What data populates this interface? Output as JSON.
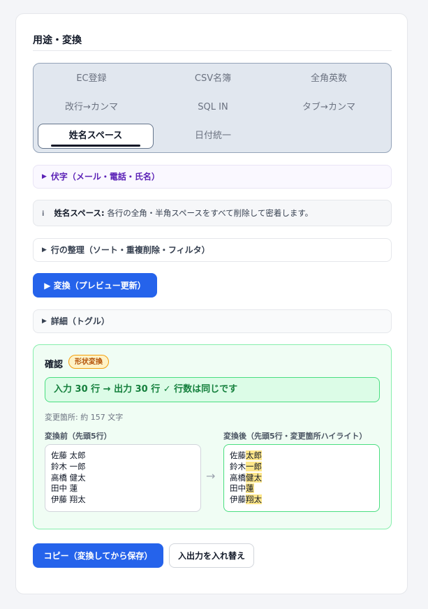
{
  "title": "用途・変換",
  "tabs": [
    {
      "label": "EC登録"
    },
    {
      "label": "CSV名簿"
    },
    {
      "label": "全角英数"
    },
    {
      "label": "改行→カンマ"
    },
    {
      "label": "SQL IN"
    },
    {
      "label": "タブ→カンマ"
    },
    {
      "label": "姓名スペース",
      "active": true
    },
    {
      "label": "日付統一"
    }
  ],
  "fuseji": {
    "label": "伏字（メール・電話・氏名）"
  },
  "info": {
    "icon": "i",
    "bold": "姓名スペース:",
    "text": "各行の全角・半角スペースをすべて削除して密着します。"
  },
  "rows_panel": {
    "label": "行の整理（ソート・重複削除・フィルタ）"
  },
  "convert_button": "▶ 変換（プレビュー更新）",
  "detail_panel": {
    "label": "詳細（トグル）"
  },
  "confirm": {
    "title": "確認",
    "badge": "形状変換",
    "result": "入力 30 行 → 出力 30 行 ✓ 行数は同じです",
    "changes": "変更箇所: 約 157 文字",
    "before_label": "変換前（先頭5行）",
    "after_label": "変換後（先頭5行・変更箇所ハイライト）",
    "arrow": "→",
    "before_lines": [
      "佐藤 太郎",
      "鈴木 一郎",
      "高橋 健太",
      "田中 蓮",
      "伊藤 翔太"
    ],
    "after_lines": [
      {
        "keep": "佐藤",
        "changed": "太郎"
      },
      {
        "keep": "鈴木",
        "changed": "一郎"
      },
      {
        "keep": "高橋",
        "changed": "健太"
      },
      {
        "keep": "田中",
        "changed": "蓮"
      },
      {
        "keep": "伊藤",
        "changed": "翔太"
      }
    ]
  },
  "copy_button": "コピー（変換してから保存）",
  "swap_button": "入出力を入れ替え",
  "colors": {
    "accent": "#2563eb",
    "success": "#15803d",
    "badge": "#b45309",
    "highlight": "#fde68a"
  }
}
